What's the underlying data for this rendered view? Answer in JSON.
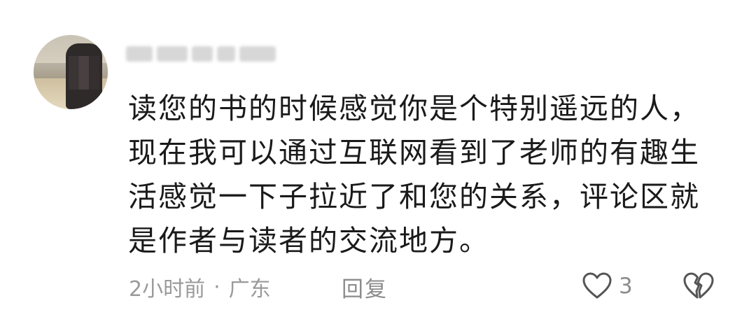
{
  "comment": {
    "username": "",
    "content_lines": [
      "读您的书的时候感觉你是个特别遥远的人，",
      "现在我可以通过互联网看到了老师的有趣生",
      "活感觉一下子拉近了和您的关系，评论区就",
      "是作者与读者的交流地方。"
    ],
    "time": "2小时前",
    "separator": "·",
    "location": "广东",
    "reply_label": "回复",
    "like_count": "3"
  },
  "icons": {
    "like": "heart-outline-icon",
    "dislike": "broken-heart-icon"
  },
  "colors": {
    "text": "#1a1a1a",
    "meta": "#9a9a9a"
  }
}
